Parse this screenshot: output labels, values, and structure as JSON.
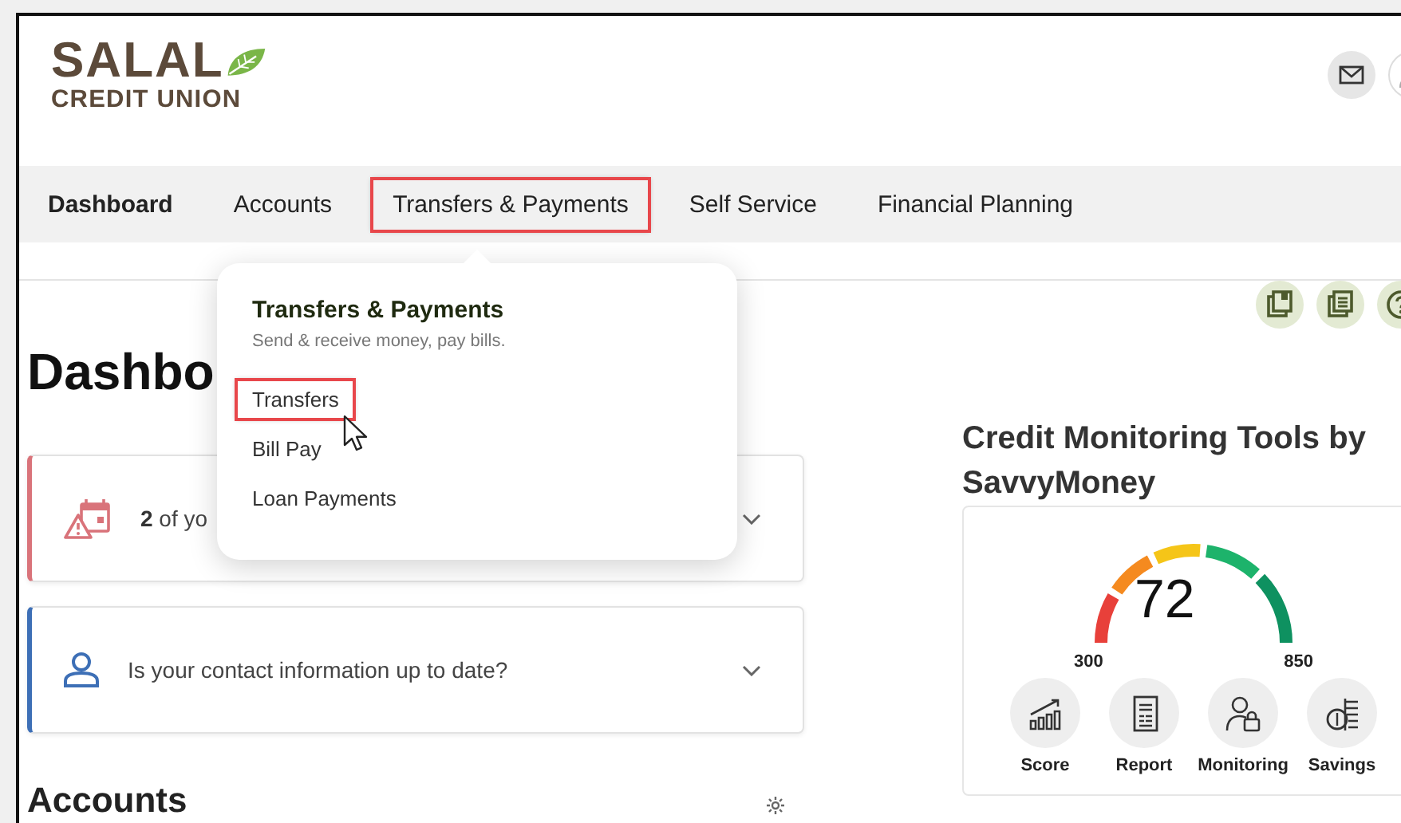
{
  "logo": {
    "name": "SALAL",
    "subtitle": "CREDIT UNION"
  },
  "nav": [
    {
      "label": "Dashboard",
      "selected": true,
      "highlighted": false
    },
    {
      "label": "Accounts",
      "selected": false,
      "highlighted": false
    },
    {
      "label": "Transfers & Payments",
      "selected": false,
      "highlighted": true
    },
    {
      "label": "Self Service",
      "selected": false,
      "highlighted": false
    },
    {
      "label": "Financial Planning",
      "selected": false,
      "highlighted": false
    }
  ],
  "menu": {
    "title": "Transfers & Payments",
    "subtitle": "Send & receive money, pay bills.",
    "items": [
      {
        "label": "Transfers",
        "highlighted": true
      },
      {
        "label": "Bill Pay",
        "highlighted": false
      },
      {
        "label": "Loan Payments",
        "highlighted": false
      }
    ]
  },
  "heading": "Dashbo",
  "alerts": [
    {
      "kind": "calendar",
      "text": "**2** of yo",
      "color": "#d9737a"
    },
    {
      "kind": "contact",
      "text": "Is your contact information up to date?",
      "color": "#3d6fb6"
    }
  ],
  "accounts_heading": "Accounts",
  "credit": {
    "title": "Credit Monitoring Tools by SavvyMoney",
    "score": "72",
    "min": "300",
    "max": "850",
    "tools": [
      {
        "label": "Score"
      },
      {
        "label": "Report"
      },
      {
        "label": "Monitoring"
      },
      {
        "label": "Savings"
      }
    ]
  }
}
